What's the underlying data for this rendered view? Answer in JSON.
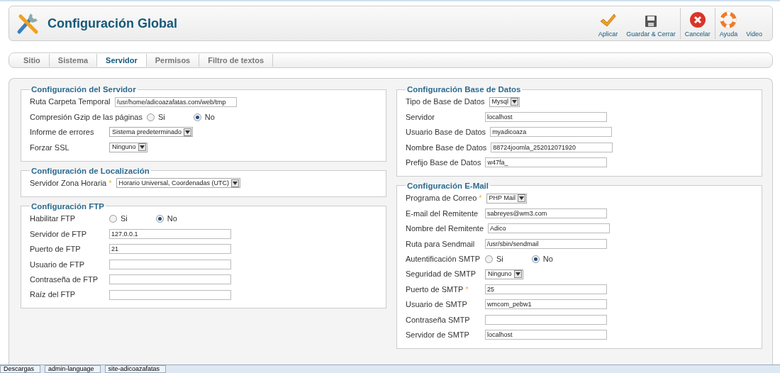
{
  "header": {
    "title": "Configuración Global",
    "toolbar": [
      {
        "kind": "apply",
        "label": "Aplicar"
      },
      {
        "kind": "save",
        "label": "Guardar & Cerrar"
      },
      {
        "kind": "cancel",
        "label": "Cancelar"
      },
      {
        "kind": "help",
        "label": "Ayuda"
      },
      {
        "kind": "video",
        "label": "Video"
      }
    ]
  },
  "tabs": [
    {
      "label": "Sitio",
      "selected": false
    },
    {
      "label": "Sistema",
      "selected": false
    },
    {
      "label": "Servidor",
      "selected": true
    },
    {
      "label": "Permisos",
      "selected": false
    },
    {
      "label": "Filtro de textos",
      "selected": false
    }
  ],
  "columns": [
    [
      {
        "title": "Configuración del Servidor",
        "fields": [
          {
            "label": "Ruta Carpeta Temporal",
            "kind": "text",
            "value": "/usr/home/adicoazafatas.com/web/tmp",
            "required": false
          },
          {
            "label": "Compresión Gzip de las páginas",
            "kind": "radio",
            "required": false,
            "options": [
              {
                "label": "Si",
                "selected": false
              },
              {
                "label": "No",
                "selected": true
              }
            ]
          },
          {
            "label": "Informe de errores",
            "kind": "select",
            "value": "Sistema predeterminado",
            "required": false
          },
          {
            "label": "Forzar SSL",
            "kind": "select",
            "value": "Ninguno",
            "required": false
          }
        ]
      },
      {
        "title": "Configuración de Localización",
        "fields": [
          {
            "label": "Servidor Zona Horaria",
            "kind": "select",
            "value": "Horario Universal, Coordenadas (UTC)",
            "required": true,
            "required_mark": "*"
          }
        ]
      },
      {
        "title": "Configuración FTP",
        "fields": [
          {
            "label": "Habilitar FTP",
            "kind": "radio",
            "required": false,
            "options": [
              {
                "label": "Si",
                "selected": false
              },
              {
                "label": "No",
                "selected": true
              }
            ]
          },
          {
            "label": "Servidor de FTP",
            "kind": "text",
            "value": "127.0.0.1",
            "required": false
          },
          {
            "label": "Puerto de FTP",
            "kind": "text",
            "value": "21",
            "required": false
          },
          {
            "label": "Usuario de FTP",
            "kind": "text",
            "required": false
          },
          {
            "label": "Contraseña de FTP",
            "kind": "text",
            "required": false
          },
          {
            "label": "Raíz del FTP",
            "kind": "text",
            "required": false
          }
        ]
      }
    ],
    [
      {
        "title": "Configuración Base de Datos",
        "fields": [
          {
            "label": "Tipo de Base de Datos",
            "kind": "select",
            "value": "Mysql",
            "required": false
          },
          {
            "label": "Servidor",
            "kind": "text",
            "value": "localhost",
            "required": false
          },
          {
            "label": "Usuario Base de Datos",
            "kind": "text",
            "value": "myadicoaza",
            "required": false
          },
          {
            "label": "Nombre Base de Datos",
            "kind": "text",
            "value": "88724joomla_252012071920",
            "required": false
          },
          {
            "label": "Prefijo Base de Datos",
            "kind": "text",
            "value": "w47fa_",
            "required": false
          }
        ]
      },
      {
        "title": "Configuración E-Mail",
        "fields": [
          {
            "label": "Programa de Correo",
            "kind": "select",
            "value": "PHP Mail",
            "required": true,
            "required_mark": "*"
          },
          {
            "label": "E-mail del Remitente",
            "kind": "text",
            "value": "sabreyes@wm3.com",
            "required": false
          },
          {
            "label": "Nombre del Remitente",
            "kind": "text",
            "value": "Adico",
            "required": false
          },
          {
            "label": "Ruta para Sendmail",
            "kind": "text",
            "value": "/usr/sbin/sendmail",
            "required": false
          },
          {
            "label": "Autentificación SMTP",
            "kind": "radio",
            "required": false,
            "options": [
              {
                "label": "Si",
                "selected": false
              },
              {
                "label": "No",
                "selected": true
              }
            ]
          },
          {
            "label": "Seguridad de SMTP",
            "kind": "select",
            "value": "Ninguno",
            "required": false
          },
          {
            "label": "Puerto de SMTP",
            "kind": "text",
            "value": "25",
            "required": true,
            "required_mark": "*"
          },
          {
            "label": "Usuario de SMTP",
            "kind": "text",
            "value": "wmcom_pebw1",
            "required": false
          },
          {
            "label": "Contraseña SMTP",
            "kind": "text",
            "required": false
          },
          {
            "label": "Servidor de SMTP",
            "kind": "text",
            "value": "localhost",
            "required": false
          }
        ]
      }
    ]
  ],
  "taskbar": [
    {
      "label": "Descargas"
    },
    {
      "label": "admin-language"
    },
    {
      "label": "site-adicoazafatas"
    }
  ]
}
